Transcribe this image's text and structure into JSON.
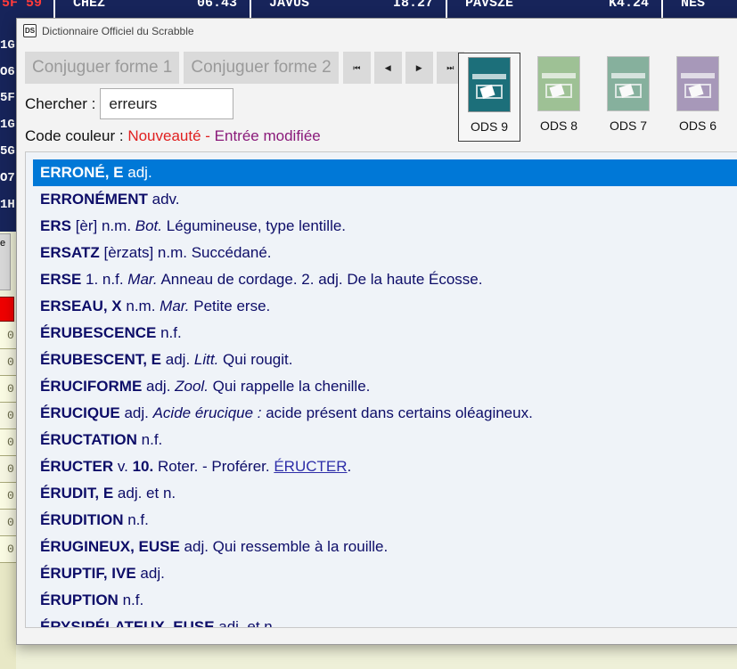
{
  "background": {
    "top_cells": [
      {
        "left": "5F 59",
        "right": ""
      },
      {
        "left": "CHEZ",
        "right": "06.43"
      },
      {
        "left": "JAVUS",
        "right": "I8.27"
      },
      {
        "left": "PAVSZE",
        "right": "K4.24"
      },
      {
        "left": "NÉS",
        "right": ""
      }
    ],
    "codes": [
      "1G",
      "O6",
      "5F",
      "1G",
      "5G",
      "O7",
      "1H"
    ],
    "button_text": "e",
    "row_values": [
      "0",
      "0",
      "0",
      "0",
      "0",
      "0",
      "0",
      "0",
      "0"
    ]
  },
  "window": {
    "title": "Dictionnaire Officiel du Scrabble",
    "icon_text": "DS"
  },
  "toolbar": {
    "conj1": "Conjuguer forme 1",
    "conj2": "Conjuguer forme 2",
    "nav_first": "⏮",
    "nav_prev": "◀",
    "nav_next": "▶",
    "nav_last": "⏭"
  },
  "search": {
    "label": "Chercher :",
    "value": "erreurs"
  },
  "legend": {
    "label": "Code couleur :",
    "new": "Nouveauté",
    "sep": " - ",
    "modified": "Entrée modifiée"
  },
  "editions": [
    {
      "label": "ODS 9",
      "color": "#1c6f7a",
      "selected": true
    },
    {
      "label": "ODS 8",
      "color": "#5a9a4a",
      "selected": false
    },
    {
      "label": "ODS 7",
      "color": "#2e7a58",
      "selected": false
    },
    {
      "label": "ODS 6",
      "color": "#6a4f8a",
      "selected": false
    }
  ],
  "entries": [
    {
      "word": "ERRONÉ, E",
      "parts": [
        {
          "t": " adj."
        }
      ]
    },
    {
      "word": "ERRONÉMENT",
      "parts": [
        {
          "t": " adv."
        }
      ]
    },
    {
      "word": "ERS",
      "parts": [
        {
          "t": " [èr] n.m. "
        },
        {
          "t": "Bot.",
          "s": "i"
        },
        {
          "t": " Légumineuse, type lentille."
        }
      ]
    },
    {
      "word": "ERSATZ",
      "parts": [
        {
          "t": " [èrzats] n.m. Succédané."
        }
      ]
    },
    {
      "word": "ERSE",
      "parts": [
        {
          "t": " 1. n.f. "
        },
        {
          "t": "Mar.",
          "s": "i"
        },
        {
          "t": " Anneau de cordage. 2. adj. De la haute Écosse."
        }
      ]
    },
    {
      "word": "ERSEAU, X",
      "parts": [
        {
          "t": " n.m. "
        },
        {
          "t": "Mar.",
          "s": "i"
        },
        {
          "t": " Petite erse."
        }
      ]
    },
    {
      "word": "ÉRUBESCENCE",
      "parts": [
        {
          "t": " n.f."
        }
      ]
    },
    {
      "word": "ÉRUBESCENT, E",
      "parts": [
        {
          "t": " adj. "
        },
        {
          "t": "Litt.",
          "s": "i"
        },
        {
          "t": " Qui rougit."
        }
      ]
    },
    {
      "word": "ÉRUCIFORME",
      "parts": [
        {
          "t": " adj. "
        },
        {
          "t": "Zool.",
          "s": "i"
        },
        {
          "t": " Qui rappelle la chenille."
        }
      ]
    },
    {
      "word": "ÉRUCIQUE",
      "parts": [
        {
          "t": " adj. "
        },
        {
          "t": "Acide érucique :",
          "s": "i"
        },
        {
          "t": " acide présent dans certains oléagineux."
        }
      ]
    },
    {
      "word": "ÉRUCTATION",
      "parts": [
        {
          "t": " n.f."
        }
      ]
    },
    {
      "word": "ÉRUCTER",
      "parts": [
        {
          "t": " v. "
        },
        {
          "t": "10.",
          "s": "b"
        },
        {
          "t": " Roter. - Proférer. "
        },
        {
          "t": "ÉRUCTER",
          "s": "link"
        },
        {
          "t": "."
        }
      ]
    },
    {
      "word": "ÉRUDIT, E",
      "parts": [
        {
          "t": " adj. et n."
        }
      ]
    },
    {
      "word": "ÉRUDITION",
      "parts": [
        {
          "t": " n.f."
        }
      ]
    },
    {
      "word": "ÉRUGINEUX, EUSE",
      "parts": [
        {
          "t": " adj. Qui ressemble à la rouille."
        }
      ]
    },
    {
      "word": "ÉRUPTIF, IVE",
      "parts": [
        {
          "t": " adj."
        }
      ]
    },
    {
      "word": "ÉRUPTION",
      "parts": [
        {
          "t": " n.f."
        }
      ]
    },
    {
      "word": "ÉRYSIPÉLATEUX, EUSE",
      "parts": [
        {
          "t": " adj. et n."
        }
      ]
    }
  ]
}
